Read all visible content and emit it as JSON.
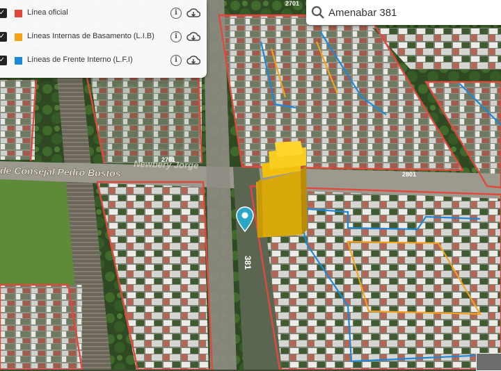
{
  "layers": [
    {
      "label": "Línea oficial",
      "color": "#e0483e",
      "checked": true,
      "info_icon": "info-icon",
      "download_icon": "cloud-download-icon"
    },
    {
      "label": "Líneas Internas de Basamento (L.I.B)",
      "color": "#f5a11a",
      "checked": true,
      "info_icon": "info-icon",
      "download_icon": "cloud-download-icon"
    },
    {
      "label": "Líneas de Frente Interno (L.F.I)",
      "color": "#1e88d8",
      "checked": true,
      "info_icon": "info-icon",
      "download_icon": "cloud-download-icon"
    }
  ],
  "search": {
    "value": "Amenabar 381",
    "icon": "search-icon"
  },
  "map": {
    "street_name": "de Consejal Pedro Bustos",
    "street_name_overlay": "Newbery Jorge",
    "street_number_1": "2701",
    "street_number_2": "2801",
    "street_number_3": "2701",
    "address_number": "381",
    "marker": "map-pin-icon",
    "building_color": "#f2bf0c",
    "official_line_color": "#e0483e",
    "lib_color": "#f5a11a",
    "lfi_color": "#1e88d8"
  }
}
